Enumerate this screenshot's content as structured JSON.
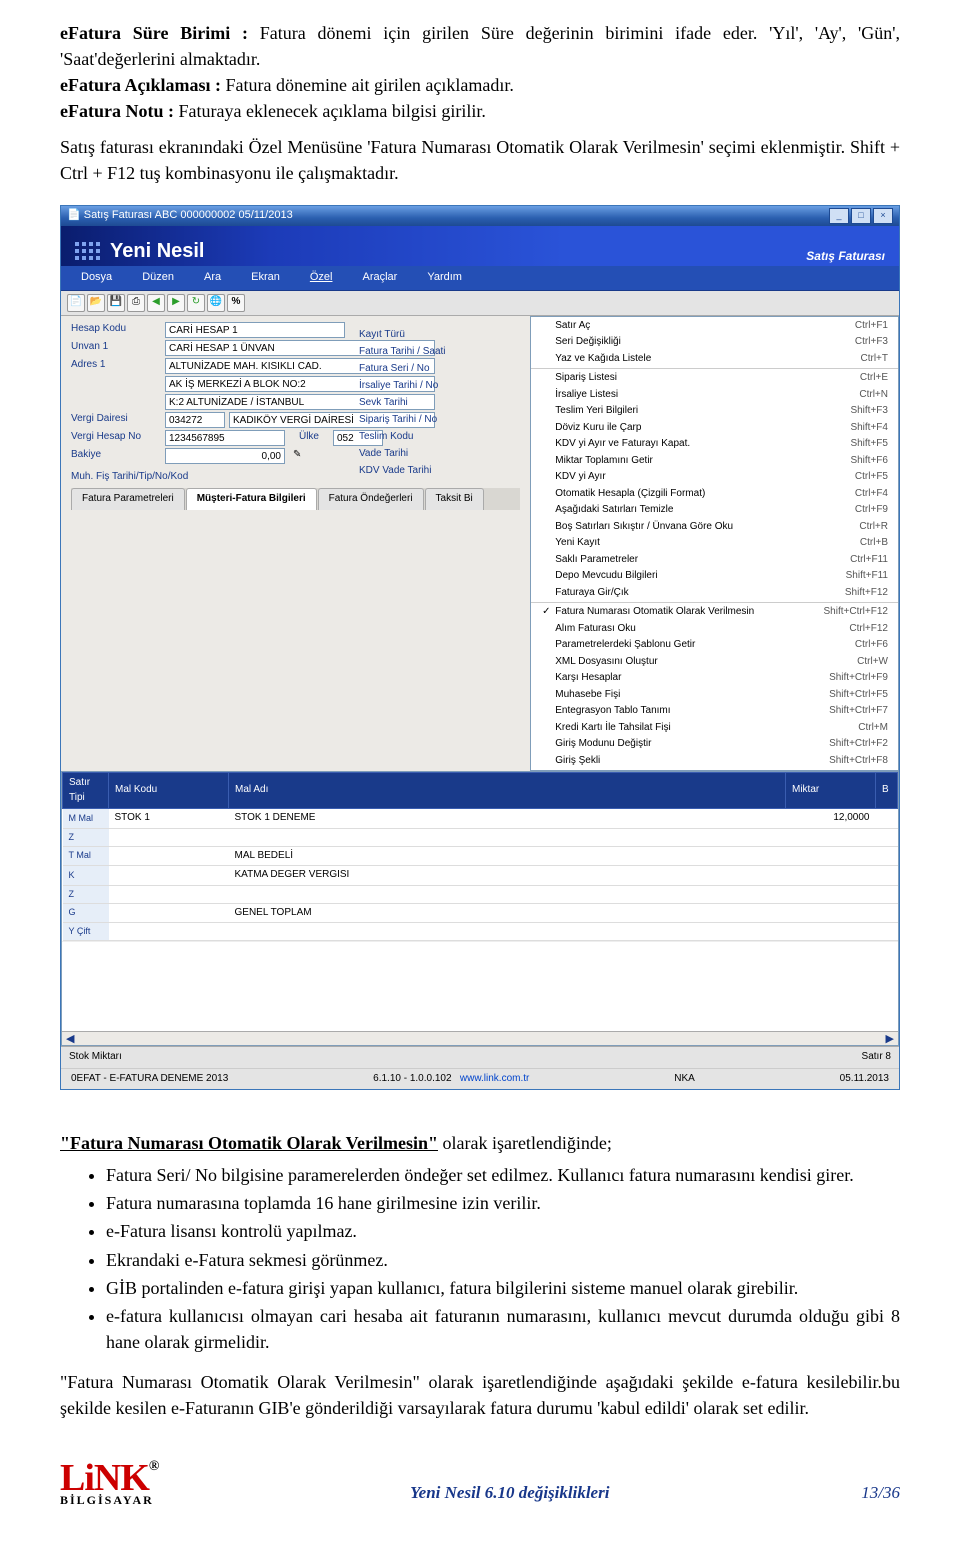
{
  "intro": {
    "p1_term": "eFatura Süre Birimi :",
    "p1_text": " Fatura dönemi için girilen Süre değerinin birimini ifade eder. 'Yıl', 'Ay', 'Gün', 'Saat'değerlerini almaktadır.",
    "p2_term": "eFatura Açıklaması :",
    "p2_text": " Fatura dönemine ait girilen açıklamadır.",
    "p3_term": "eFatura Notu :",
    "p3_text": " Faturaya eklenecek açıklama bilgisi girilir.",
    "p4": "Satış faturası ekranındaki Özel Menüsüne 'Fatura Numarası Otomatik Olarak Verilmesin' seçimi eklenmiştir. Shift + Ctrl + F12 tuş kombinasyonu ile çalışmaktadır."
  },
  "screenshot": {
    "titlebar": "Satış Faturası  ABC 000000002 05/11/2013",
    "brand": "Yeni Nesil",
    "brand_right": "Satış Faturası",
    "menu": [
      "Dosya",
      "Düzen",
      "Ara",
      "Ekran",
      "Özel",
      "Araçlar",
      "Yardım"
    ],
    "toolbar_pct": "%",
    "form": {
      "labels": {
        "hesap": "Hesap Kodu",
        "unvan": "Unvan 1",
        "adres": "Adres 1",
        "vergi_d": "Vergi Dairesi",
        "vergi_no": "Vergi Hesap No",
        "bakiye": "Bakiye",
        "ulke": "Ülke",
        "muh": "Muh. Fiş Tarihi/Tip/No/Kod",
        "sagcol": [
          "Kayıt Türü",
          "Fatura Tarihi / Saati",
          "Fatura Seri / No",
          "İrsaliye Tarihi / No",
          "Sevk Tarihi",
          "Sipariş Tarihi / No",
          "Teslim Kodu",
          "Vade Tarihi",
          "KDV Vade Tarihi"
        ]
      },
      "vals": {
        "hesap": "CARİ HESAP 1",
        "unvan": "CARİ HESAP 1 ÜNVAN",
        "adres1": "ALTUNİZADE MAH. KISIKLI CAD.",
        "adres2": "AK İŞ MERKEZİ A BLOK NO:2",
        "adres3": "K:2  ALTUNİZADE / İSTANBUL",
        "vergi_d1": "034272",
        "vergi_d2": "KADIKÖY VERGİ DAİRESİ",
        "vergi_no": "1234567895",
        "ulke": "052",
        "bakiye": "0,00"
      }
    },
    "tabs": [
      "Fatura Parametreleri",
      "Müşteri-Fatura Bilgileri",
      "Fatura Öndeğerleri",
      "Taksit Bi"
    ],
    "grid": {
      "headers": [
        "Satır Tipi",
        "Mal Kodu",
        "Mal Adı",
        "Miktar",
        "B"
      ],
      "rows": [
        {
          "tip": "M Mal",
          "kod": "STOK 1",
          "ad": "STOK 1 DENEME",
          "miktar": "12,0000"
        },
        {
          "tip": "Z",
          "kod": "",
          "ad": "",
          "miktar": ""
        },
        {
          "tip": "T Mal",
          "kod": "",
          "ad": "MAL BEDELİ",
          "miktar": ""
        },
        {
          "tip": "K",
          "kod": "",
          "ad": "KATMA DEGER VERGISI",
          "miktar": ""
        },
        {
          "tip": "Z",
          "kod": "",
          "ad": "",
          "miktar": ""
        },
        {
          "tip": "G",
          "kod": "",
          "ad": "GENEL TOPLAM",
          "miktar": ""
        },
        {
          "tip": "Y Çift",
          "kod": "",
          "ad": "",
          "miktar": ""
        }
      ]
    },
    "menu_ozel": [
      {
        "t": "Satır Aç",
        "s": "Ctrl+F1"
      },
      {
        "t": "Seri Değişikliği",
        "s": "Ctrl+F3"
      },
      {
        "t": "Yaz ve Kağıda Listele",
        "s": "Ctrl+T"
      },
      {
        "t": "Sipariş Listesi",
        "s": "Ctrl+E"
      },
      {
        "t": "İrsaliye Listesi",
        "s": "Ctrl+N"
      },
      {
        "t": "Teslim Yeri Bilgileri",
        "s": "Shift+F3"
      },
      {
        "t": "Döviz Kuru ile Çarp",
        "s": "Shift+F4"
      },
      {
        "t": "KDV yi Ayır ve Faturayı Kapat.",
        "s": "Shift+F5"
      },
      {
        "t": "Miktar Toplamını Getir",
        "s": "Shift+F6"
      },
      {
        "t": "KDV yi Ayır",
        "s": "Ctrl+F5"
      },
      {
        "t": "Otomatik Hesapla (Çizgili Format)",
        "s": "Ctrl+F4"
      },
      {
        "t": "Aşağıdaki Satırları Temizle",
        "s": "Ctrl+F9"
      },
      {
        "t": "Boş Satırları Sıkıştır / Ünvana Göre Oku",
        "s": "Ctrl+R"
      },
      {
        "t": "Yeni Kayıt",
        "s": "Ctrl+B"
      },
      {
        "t": "Saklı Parametreler",
        "s": "Ctrl+F11"
      },
      {
        "t": "Depo Mevcudu Bilgileri",
        "s": "Shift+F11"
      },
      {
        "t": "Faturaya Gir/Çık",
        "s": "Shift+F12"
      },
      {
        "t": "Fatura Numarası Otomatik Olarak Verilmesin",
        "s": "Shift+Ctrl+F12",
        "ck": "✓"
      },
      {
        "t": "Alım Faturası Oku",
        "s": "Ctrl+F12"
      },
      {
        "t": "Parametrelerdeki Şablonu Getir",
        "s": "Ctrl+F6"
      },
      {
        "t": "XML Dosyasını Oluştur",
        "s": "Ctrl+W"
      },
      {
        "t": "Karşı Hesaplar",
        "s": "Shift+Ctrl+F9"
      },
      {
        "t": "Muhasebe Fişi",
        "s": "Shift+Ctrl+F5"
      },
      {
        "t": "Entegrasyon Tablo Tanımı",
        "s": "Shift+Ctrl+F7"
      },
      {
        "t": "Kredi Kartı İle Tahsilat Fişi",
        "s": "Ctrl+M"
      },
      {
        "t": "Giriş Modunu Değiştir",
        "s": "Shift+Ctrl+F2"
      },
      {
        "t": "Giriş Şekli",
        "s": "Shift+Ctrl+F8"
      }
    ],
    "status": {
      "stok": "Stok Miktarı",
      "satir": "Satır   8"
    },
    "verinfo": {
      "left": "0EFAT - E-FATURA DENEME 2013",
      "mid": "6.1.10 - 1.0.0.102",
      "url": "www.link.com.tr",
      "user": "NKA",
      "date": "05.11.2013"
    }
  },
  "body2": {
    "h": "\"Fatura Numarası Otomatik Olarak Verilmesin\"",
    "h_tail": " olarak işaretlendiğinde;",
    "bullets": [
      "Fatura Seri/ No bilgisine  paramerelerden öndeğer set edilmez. Kullanıcı fatura numarasını kendisi girer.",
      "Fatura numarasına toplamda 16 hane girilmesine izin verilir.",
      "e-Fatura lisansı kontrolü yapılmaz.",
      "Ekrandaki e-Fatura sekmesi görünmez.",
      "GİB portalinden e-fatura girişi yapan kullanıcı, fatura bilgilerini sisteme manuel olarak girebilir.",
      "e-fatura kullanıcısı olmayan cari hesaba ait faturanın numarasını, kullanıcı mevcut durumda olduğu gibi 8 hane olarak girmelidir."
    ],
    "p": "\"Fatura Numarası Otomatik Olarak Verilmesin\" olarak işaretlendiğinde aşağıdaki şekilde e-fatura kesilebilir.bu şekilde kesilen e-Faturanın GIB'e gönderildiği varsayılarak fatura durumu 'kabul edildi' olarak set edilir."
  },
  "footer": {
    "brand": "LiNK",
    "reg": "®",
    "sub": "BİLGİSAYAR",
    "title": "Yeni Nesil 6.10 değişiklikleri",
    "page": "13/36"
  }
}
